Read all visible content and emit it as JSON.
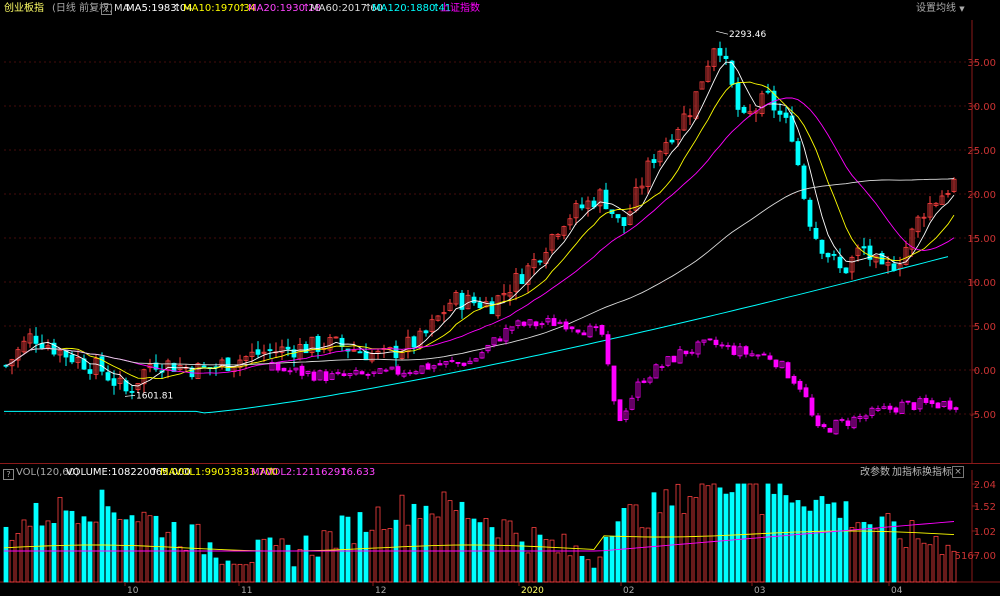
{
  "header": {
    "index_name": "创业板指",
    "period": "(日线 前复权)",
    "help": "?",
    "ma_label": "MA",
    "ma5": "MA5:1983.04",
    "ma10": "MA10:1970.34",
    "ma20": "MA20:1930.28",
    "ma60": "MA60:2017.60",
    "ma120": "MA120:1880.41",
    "overlay": "上证指数",
    "settings": "设置均线"
  },
  "price_axis": [
    "35.00",
    "30.00",
    "25.00",
    "20.00",
    "15.00",
    "10.00",
    "5.00",
    "0.00",
    "-5.00"
  ],
  "annotations": {
    "high": "2293.46",
    "low": "1601.81"
  },
  "volume": {
    "label": "VOL(120,60)",
    "value": "VOLUME:108220065.000",
    "mavol1": "MAVOL1:99033833.700",
    "mavol2": "MAVOL2:121162916.633",
    "axis": [
      "2.04",
      "1.52",
      "1.02",
      "5167.00"
    ],
    "buttons": [
      "改参数",
      "加指标",
      "换指标"
    ]
  },
  "date_axis": [
    "10",
    "11",
    "12",
    "2020",
    "02",
    "03",
    "04"
  ],
  "colors": {
    "up": "#ff4040",
    "down": "#00ffff",
    "ma5": "#ffffff",
    "ma10": "#ffff00",
    "ma20": "#ff00ff",
    "ma60": "#dddddd",
    "ma120": "#00ffff",
    "overlay": "#ff00ff",
    "grid": "#8b1a1a"
  },
  "icons": {
    "arrow": "up-arrow-icon",
    "dropdown": "triangle-down-icon",
    "close": "close-icon"
  }
}
